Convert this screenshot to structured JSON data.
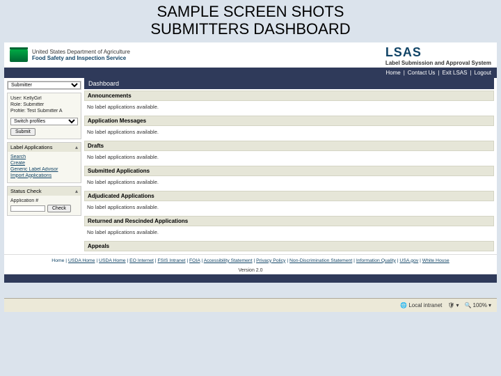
{
  "slide": {
    "title_line1": "SAMPLE SCREEN SHOTS",
    "title_line2": "SUBMITTERS DASHBOARD"
  },
  "header": {
    "dept": "United States Department of Agriculture",
    "agency": "Food Safety and Inspection Service",
    "brand_acronym": "LSAS",
    "brand_full": "Label Submission and Approval System"
  },
  "topnav": [
    "Home",
    "Contact Us",
    "Exit LSAS",
    "Logout"
  ],
  "sidebar": {
    "role_select": "Submitter",
    "user_line": "User: KellyGirl",
    "role_line": "Role: Submitter",
    "profile_line": "Profile: Test Submitter A",
    "switch_select": "Switch profiles",
    "submit_btn": "Submit",
    "la_header": "Label Applications",
    "la_links": [
      "Search",
      "Create",
      "Generic Label Advisor",
      "Import Applications"
    ],
    "sc_header": "Status Check",
    "sc_field_label": "Application #",
    "sc_btn": "Check"
  },
  "content": {
    "title": "Dashboard",
    "sections": [
      {
        "head": "Announcements",
        "body": "No label applications available."
      },
      {
        "head": "Application Messages",
        "body": "No label applications available."
      },
      {
        "head": "Drafts",
        "body": "No label applications available."
      },
      {
        "head": "Submitted Applications",
        "body": "No label applications available."
      },
      {
        "head": "Adjudicated Applications",
        "body": "No label applications available."
      },
      {
        "head": "Returned and Rescinded Applications",
        "body": "No label applications available."
      },
      {
        "head": "Appeals",
        "body": ""
      }
    ]
  },
  "footer": {
    "prefix": "Home",
    "links": [
      "USDA Home",
      "USDA Home",
      "EO Internet",
      "FSIS Intranet",
      "FOIA",
      "Accessibility Statement",
      "Privacy Policy",
      "Non-Discrimination Statement",
      "Information Quality",
      "USA.gov",
      "White House"
    ],
    "version": "Version 2.0"
  },
  "taskbar": {
    "intranet": "Local intranet",
    "zoom": "100%"
  }
}
